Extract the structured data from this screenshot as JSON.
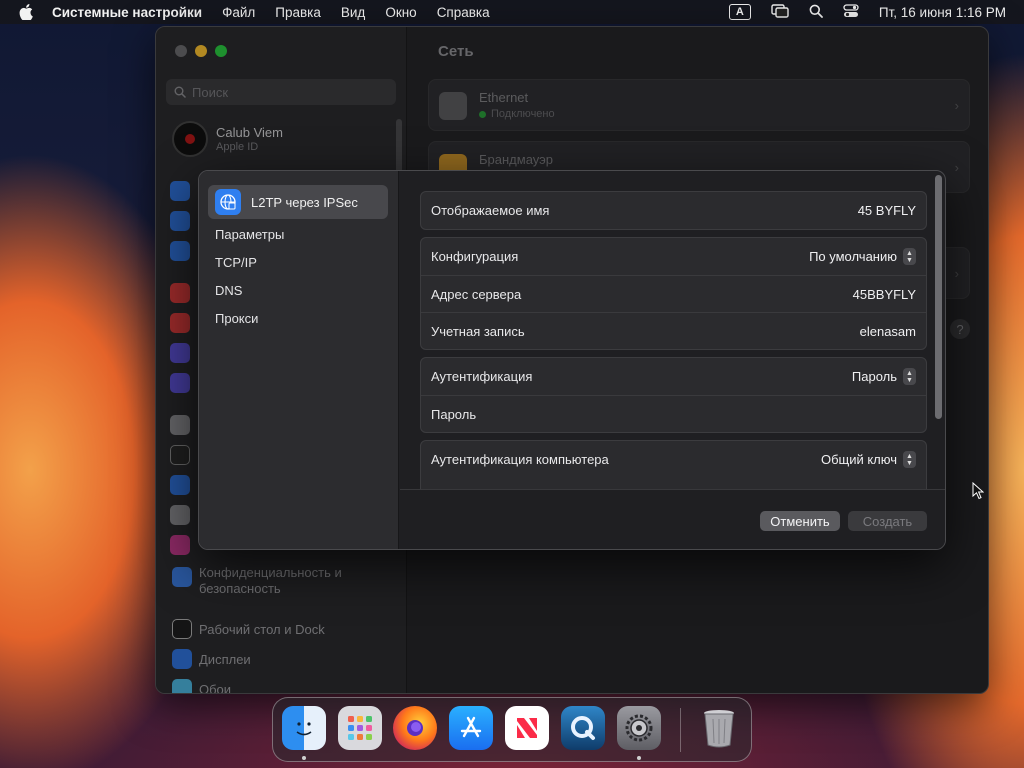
{
  "menubar": {
    "app_name": "Системные настройки",
    "menus": [
      "Файл",
      "Правка",
      "Вид",
      "Окно",
      "Справка"
    ],
    "keyboard_badge": "A",
    "datetime": "Пт, 16 июня  1:16 PM"
  },
  "window": {
    "title": "Сеть",
    "search_placeholder": "Поиск",
    "account": {
      "name": "Calub Viem",
      "subtitle": "Apple ID"
    },
    "sidebar_items": [
      {
        "label": "Конфиденциальность и безопасность"
      },
      {
        "label": "Рабочий стол и Dock"
      },
      {
        "label": "Дисплеи"
      },
      {
        "label": "Обои"
      }
    ],
    "network_cards": [
      {
        "title": "Ethernet",
        "status": "Подключено"
      },
      {
        "title": "Брандмауэр",
        "status": ""
      }
    ]
  },
  "sheet": {
    "vpn_name": "L2TP через IPSec",
    "tabs": [
      "Параметры",
      "TCP/IP",
      "DNS",
      "Прокси"
    ],
    "display_name": {
      "label": "Отображаемое имя",
      "value": "45 BYFLY"
    },
    "configuration": {
      "label": "Конфигурация",
      "value": "По умолчанию"
    },
    "server_address": {
      "label": "Адрес сервера",
      "value": "45BBYFLY"
    },
    "account": {
      "label": "Учетная запись",
      "value": "elenasam"
    },
    "authentication": {
      "label": "Аутентификация",
      "value": "Пароль"
    },
    "password": {
      "label": "Пароль",
      "value": ""
    },
    "machine_auth": {
      "label": "Аутентификация компьютера",
      "value": "Общий ключ"
    },
    "cancel_label": "Отменить",
    "create_label": "Создать"
  },
  "dock": {
    "apps": [
      "finder-icon",
      "launchpad-icon",
      "firefox-icon",
      "app-store-icon",
      "news-icon",
      "quicktime-icon",
      "system-settings-icon",
      "trash-icon"
    ]
  },
  "colors": {
    "accent": "#2f7ff0",
    "connected": "#2a9a3a"
  }
}
